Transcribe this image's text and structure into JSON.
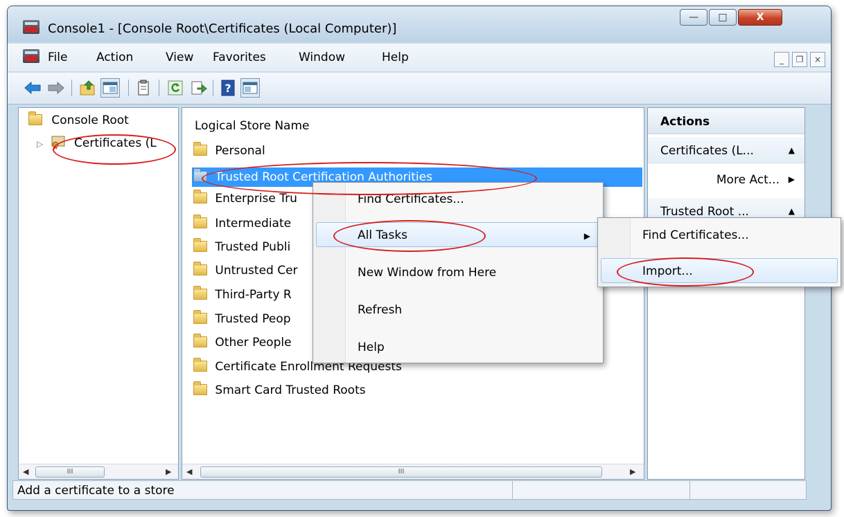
{
  "window": {
    "title": "Console1 - [Console Root\\Certificates (Local Computer)]",
    "caption_minimize": "—",
    "caption_maximize": "□",
    "caption_close": "X"
  },
  "menubar": {
    "items": [
      "File",
      "Action",
      "View",
      "Favorites",
      "Window",
      "Help"
    ],
    "mdi_minimize": "_",
    "mdi_restore": "❐",
    "mdi_close": "×"
  },
  "toolbar": {
    "icons": [
      "back-arrow-icon",
      "forward-arrow-icon",
      "up-folder-icon",
      "show-hide-tree-icon",
      "properties-icon",
      "refresh-icon",
      "export-list-icon",
      "help-icon",
      "show-hide-action-pane-icon"
    ]
  },
  "tree": {
    "root": "Console Root",
    "child": "Certificates (L",
    "expand_glyph": "▷"
  },
  "list": {
    "column_header": "Logical Store Name",
    "items": [
      "Personal",
      "Trusted Root Certification Authorities",
      "Enterprise Tru",
      "Intermediate",
      "Trusted Publi",
      "Untrusted Cer",
      "Third-Party R",
      "Trusted Peop",
      "Other People",
      "Certificate Enrollment Requests",
      "Smart Card Trusted Roots"
    ],
    "selected_index": 1
  },
  "scrollbar": {
    "left_arrow": "◀",
    "right_arrow": "▶",
    "thumb_grip": "III"
  },
  "actions": {
    "title": "Actions",
    "group1": "Certificates (L...",
    "group1_more": "More Act...",
    "group2": "Trusted Root ...",
    "collapse_glyph": "▲",
    "more_glyph": "▶"
  },
  "context_menu": {
    "items": [
      "Find Certificates...",
      "All Tasks",
      "New Window from Here",
      "Refresh",
      "Help"
    ],
    "submenu_arrow": "▶",
    "highlighted": "All Tasks"
  },
  "submenu": {
    "items": [
      "Find Certificates...",
      "Import..."
    ],
    "highlighted": "Import..."
  },
  "status": {
    "text": "Add a certificate to a store"
  },
  "colors": {
    "selection": "#3399ff",
    "annotation": "#d81e1e",
    "menu_highlight_border": "#9fc3ea"
  }
}
